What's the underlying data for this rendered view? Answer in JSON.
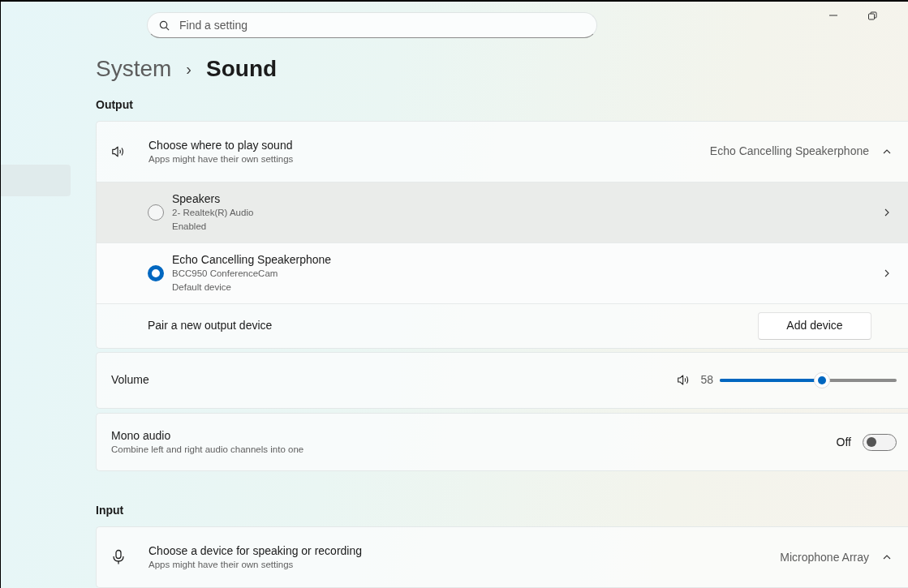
{
  "search": {
    "placeholder": "Find a setting"
  },
  "breadcrumb": {
    "parent": "System",
    "separator": "›",
    "current": "Sound"
  },
  "output": {
    "heading": "Output",
    "device_picker": {
      "title": "Choose where to play sound",
      "subtitle": "Apps might have their own settings",
      "value": "Echo Cancelling Speakerphone",
      "expanded": true
    },
    "devices": [
      {
        "name": "Speakers",
        "detail": "2- Realtek(R) Audio",
        "status": "Enabled",
        "selected": false,
        "hovered": true
      },
      {
        "name": "Echo Cancelling Speakerphone",
        "detail": "BCC950 ConferenceCam",
        "status": "Default device",
        "selected": true,
        "hovered": false
      }
    ],
    "pair": {
      "label": "Pair a new output device",
      "button": "Add device"
    },
    "volume": {
      "label": "Volume",
      "reading": "58",
      "level": 0.58
    },
    "mono": {
      "title": "Mono audio",
      "subtitle": "Combine left and right audio channels into one",
      "state_label": "Off",
      "on": false
    }
  },
  "input": {
    "heading": "Input",
    "device_picker": {
      "title": "Choose a device for speaking or recording",
      "subtitle": "Apps might have their own settings",
      "value": "Microphone Array",
      "expanded": true
    }
  }
}
